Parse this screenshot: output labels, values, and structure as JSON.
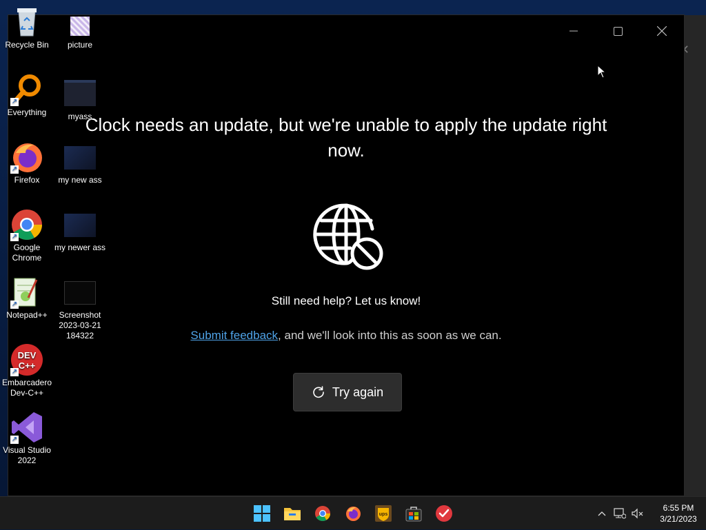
{
  "app_window": {
    "message": "Clock needs an update, but we're unable to apply the update right now.",
    "help_text": "Still need help? Let us know!",
    "feedback_link": "Submit feedback",
    "feedback_rest": ", and we'll look into this as soon as we can.",
    "try_again_label": "Try again"
  },
  "desktop_icons": {
    "recycle_bin": "Recycle Bin",
    "picture": "picture",
    "everything": "Everything",
    "myass": "myass",
    "firefox": "Firefox",
    "my_new_ass": "my new ass",
    "google_chrome": "Google Chrome",
    "my_newer_ass": "my newer ass",
    "notepad_pp": "Notepad++",
    "screenshot": "Screenshot 2023-03-21 184322",
    "devcpp": "Embarcadero Dev-C++",
    "visual_studio": "Visual Studio 2022"
  },
  "taskbar": {
    "apps": [
      "start-icon",
      "file-explorer-icon",
      "chrome-icon",
      "firefox-icon",
      "ups-icon",
      "store-icon",
      "todo-icon"
    ],
    "time": "6:55 PM",
    "date": "3/21/2023"
  },
  "colors": {
    "link": "#4fa3e8",
    "window_bg": "#000000",
    "taskbar_bg": "#1c1c1c"
  }
}
